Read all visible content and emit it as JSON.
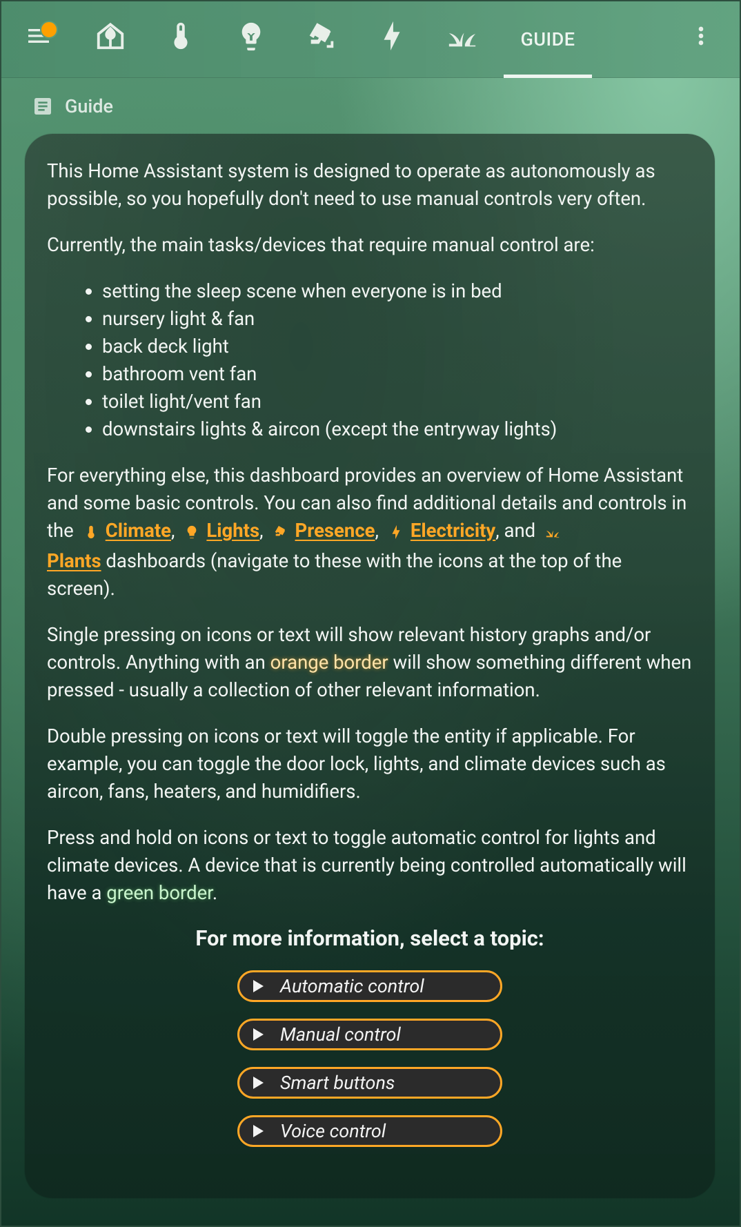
{
  "toolbar": {
    "tabs": [
      {
        "icon": "home-floor-plan-icon"
      },
      {
        "icon": "thermometer-icon"
      },
      {
        "icon": "lightbulb-icon"
      },
      {
        "icon": "cctv-icon"
      },
      {
        "icon": "lightning-bolt-icon"
      },
      {
        "icon": "grass-icon"
      }
    ],
    "active_tab_label": "GUIDE",
    "badge_color": "#ffa000"
  },
  "card": {
    "header_title": "Guide",
    "intro": "This Home Assistant system is designed to operate as autonomously as possible, so you hopefully don't need to use manual controls very often.",
    "manual_intro": "Currently, the main tasks/devices that require manual control are:",
    "manual_items": [
      "setting the sleep scene when everyone is in bed",
      "nursery light & fan",
      "back deck light",
      "bathroom vent fan",
      "toilet light/vent fan",
      "downstairs lights & aircon (except the entryway lights)"
    ],
    "overview_text_1": "For everything else, this dashboard provides an overview of Home Assistant and some basic controls. You can also find additional details and controls in the",
    "links": {
      "climate": "Climate",
      "lights": "Lights",
      "presence": "Presence",
      "electricity": "Electricity",
      "plants": "Plants"
    },
    "and_text": ", and",
    "overview_text_2": "dashboards (navigate to these with the icons at the top of the screen).",
    "single_press_1": "Single pressing on icons or text will show relevant history graphs and/or controls. Anything with an",
    "orange_border": "orange border",
    "single_press_2": "will show something different when pressed - usually a collection of other relevant information.",
    "double_press": "Double pressing on icons or text will toggle the entity if applicable. For example, you can toggle the door lock, lights, and climate devices such as aircon, fans, heaters, and humidifiers.",
    "hold_1": "Press and hold on icons or text to toggle automatic control for lights and climate devices. A device that is currently being controlled automatically will have a",
    "green_border": "green border",
    "topics_heading": "For more information, select a topic:",
    "topics": [
      "Automatic control",
      "Manual control",
      "Smart buttons",
      "Voice control"
    ],
    "accent_color": "#ffa726"
  }
}
